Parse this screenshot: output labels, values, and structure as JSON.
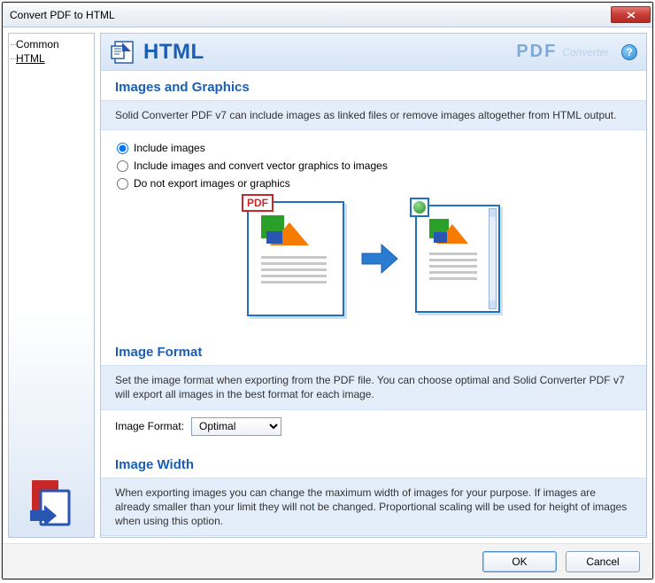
{
  "window": {
    "title": "Convert PDF to HTML"
  },
  "sidebar": {
    "items": [
      "Common",
      "HTML"
    ],
    "selected_index": 1
  },
  "header": {
    "page_title": "HTML",
    "brand_pdf": "PDF",
    "brand_conv": "Converter"
  },
  "sections": {
    "images": {
      "title": "Images and Graphics",
      "desc": "Solid Converter PDF v7 can include images as linked files or remove images altogether from HTML output.",
      "options": [
        "Include images",
        "Include images and convert vector graphics to images",
        "Do not export  images or graphics"
      ],
      "selected": 0,
      "pdf_label": "PDF"
    },
    "format": {
      "title": "Image Format",
      "desc": "Set the image format when exporting from the PDF file. You can choose optimal and Solid Converter PDF v7 will export all images in the best format for each image.",
      "label": "Image Format:",
      "value": "Optimal",
      "options": [
        "Optimal"
      ]
    },
    "width": {
      "title": "Image Width",
      "desc": "When exporting images you can change the maximum width of images for your purpose. If images are already smaller than your limit they will not be changed. Proportional scaling will be used for height of images when using this option."
    }
  },
  "buttons": {
    "ok": "OK",
    "cancel": "Cancel"
  },
  "help_glyph": "?"
}
